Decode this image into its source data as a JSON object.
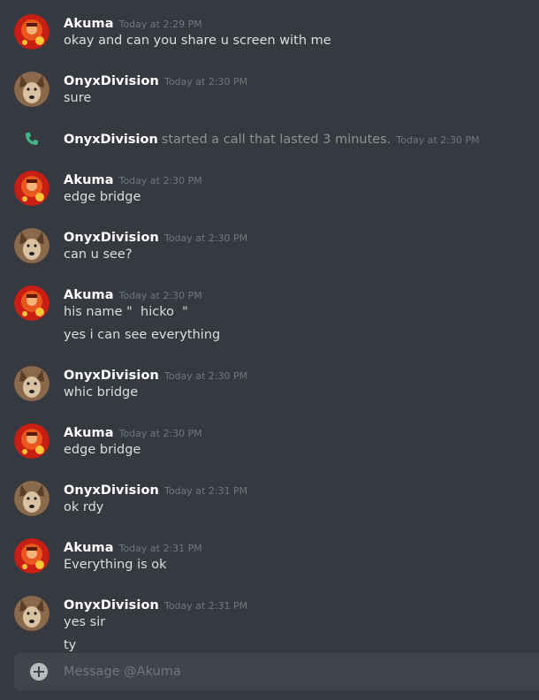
{
  "users": {
    "akuma": "Akuma",
    "onyx": "OnyxDivision"
  },
  "messages": [
    {
      "author": "Akuma",
      "time": "Today at 2:29 PM",
      "lines": [
        "okay and can you share u screen with me"
      ]
    },
    {
      "author": "OnyxDivision",
      "time": "Today at 2:30 PM",
      "lines": [
        "sure"
      ]
    },
    {
      "author": "Akuma",
      "time": "Today at 2:30 PM",
      "lines": [
        "edge bridge"
      ]
    },
    {
      "author": "OnyxDivision",
      "time": "Today at 2:30 PM",
      "lines": [
        "can u see?"
      ]
    },
    {
      "author": "Akuma",
      "time": "Today at 2:30 PM",
      "lines": [
        "his name \"  hicko  \"",
        "yes i can see everything"
      ]
    },
    {
      "author": "OnyxDivision",
      "time": "Today at 2:30 PM",
      "lines": [
        "whic bridge"
      ]
    },
    {
      "author": "Akuma",
      "time": "Today at 2:30 PM",
      "lines": [
        "edge bridge"
      ]
    },
    {
      "author": "OnyxDivision",
      "time": "Today at 2:31 PM",
      "lines": [
        "ok rdy"
      ]
    },
    {
      "author": "Akuma",
      "time": "Today at 2:31 PM",
      "lines": [
        "Everything is ok"
      ]
    },
    {
      "author": "OnyxDivision",
      "time": "Today at 2:31 PM",
      "lines": [
        "yes sir",
        "ty"
      ]
    }
  ],
  "call": {
    "author": "OnyxDivision",
    "text": "started a call that lasted 3 minutes.",
    "time": "Today at 2:30 PM",
    "icon": "phone-icon"
  },
  "composer": {
    "placeholder": "Message @Akuma",
    "attach_icon": "add-attachment-icon"
  },
  "colors": {
    "background": "#36393f",
    "input": "#40444b",
    "username": "#ffffff",
    "text": "#dcddde",
    "muted": "#72767d",
    "call_green": "#43b581"
  }
}
